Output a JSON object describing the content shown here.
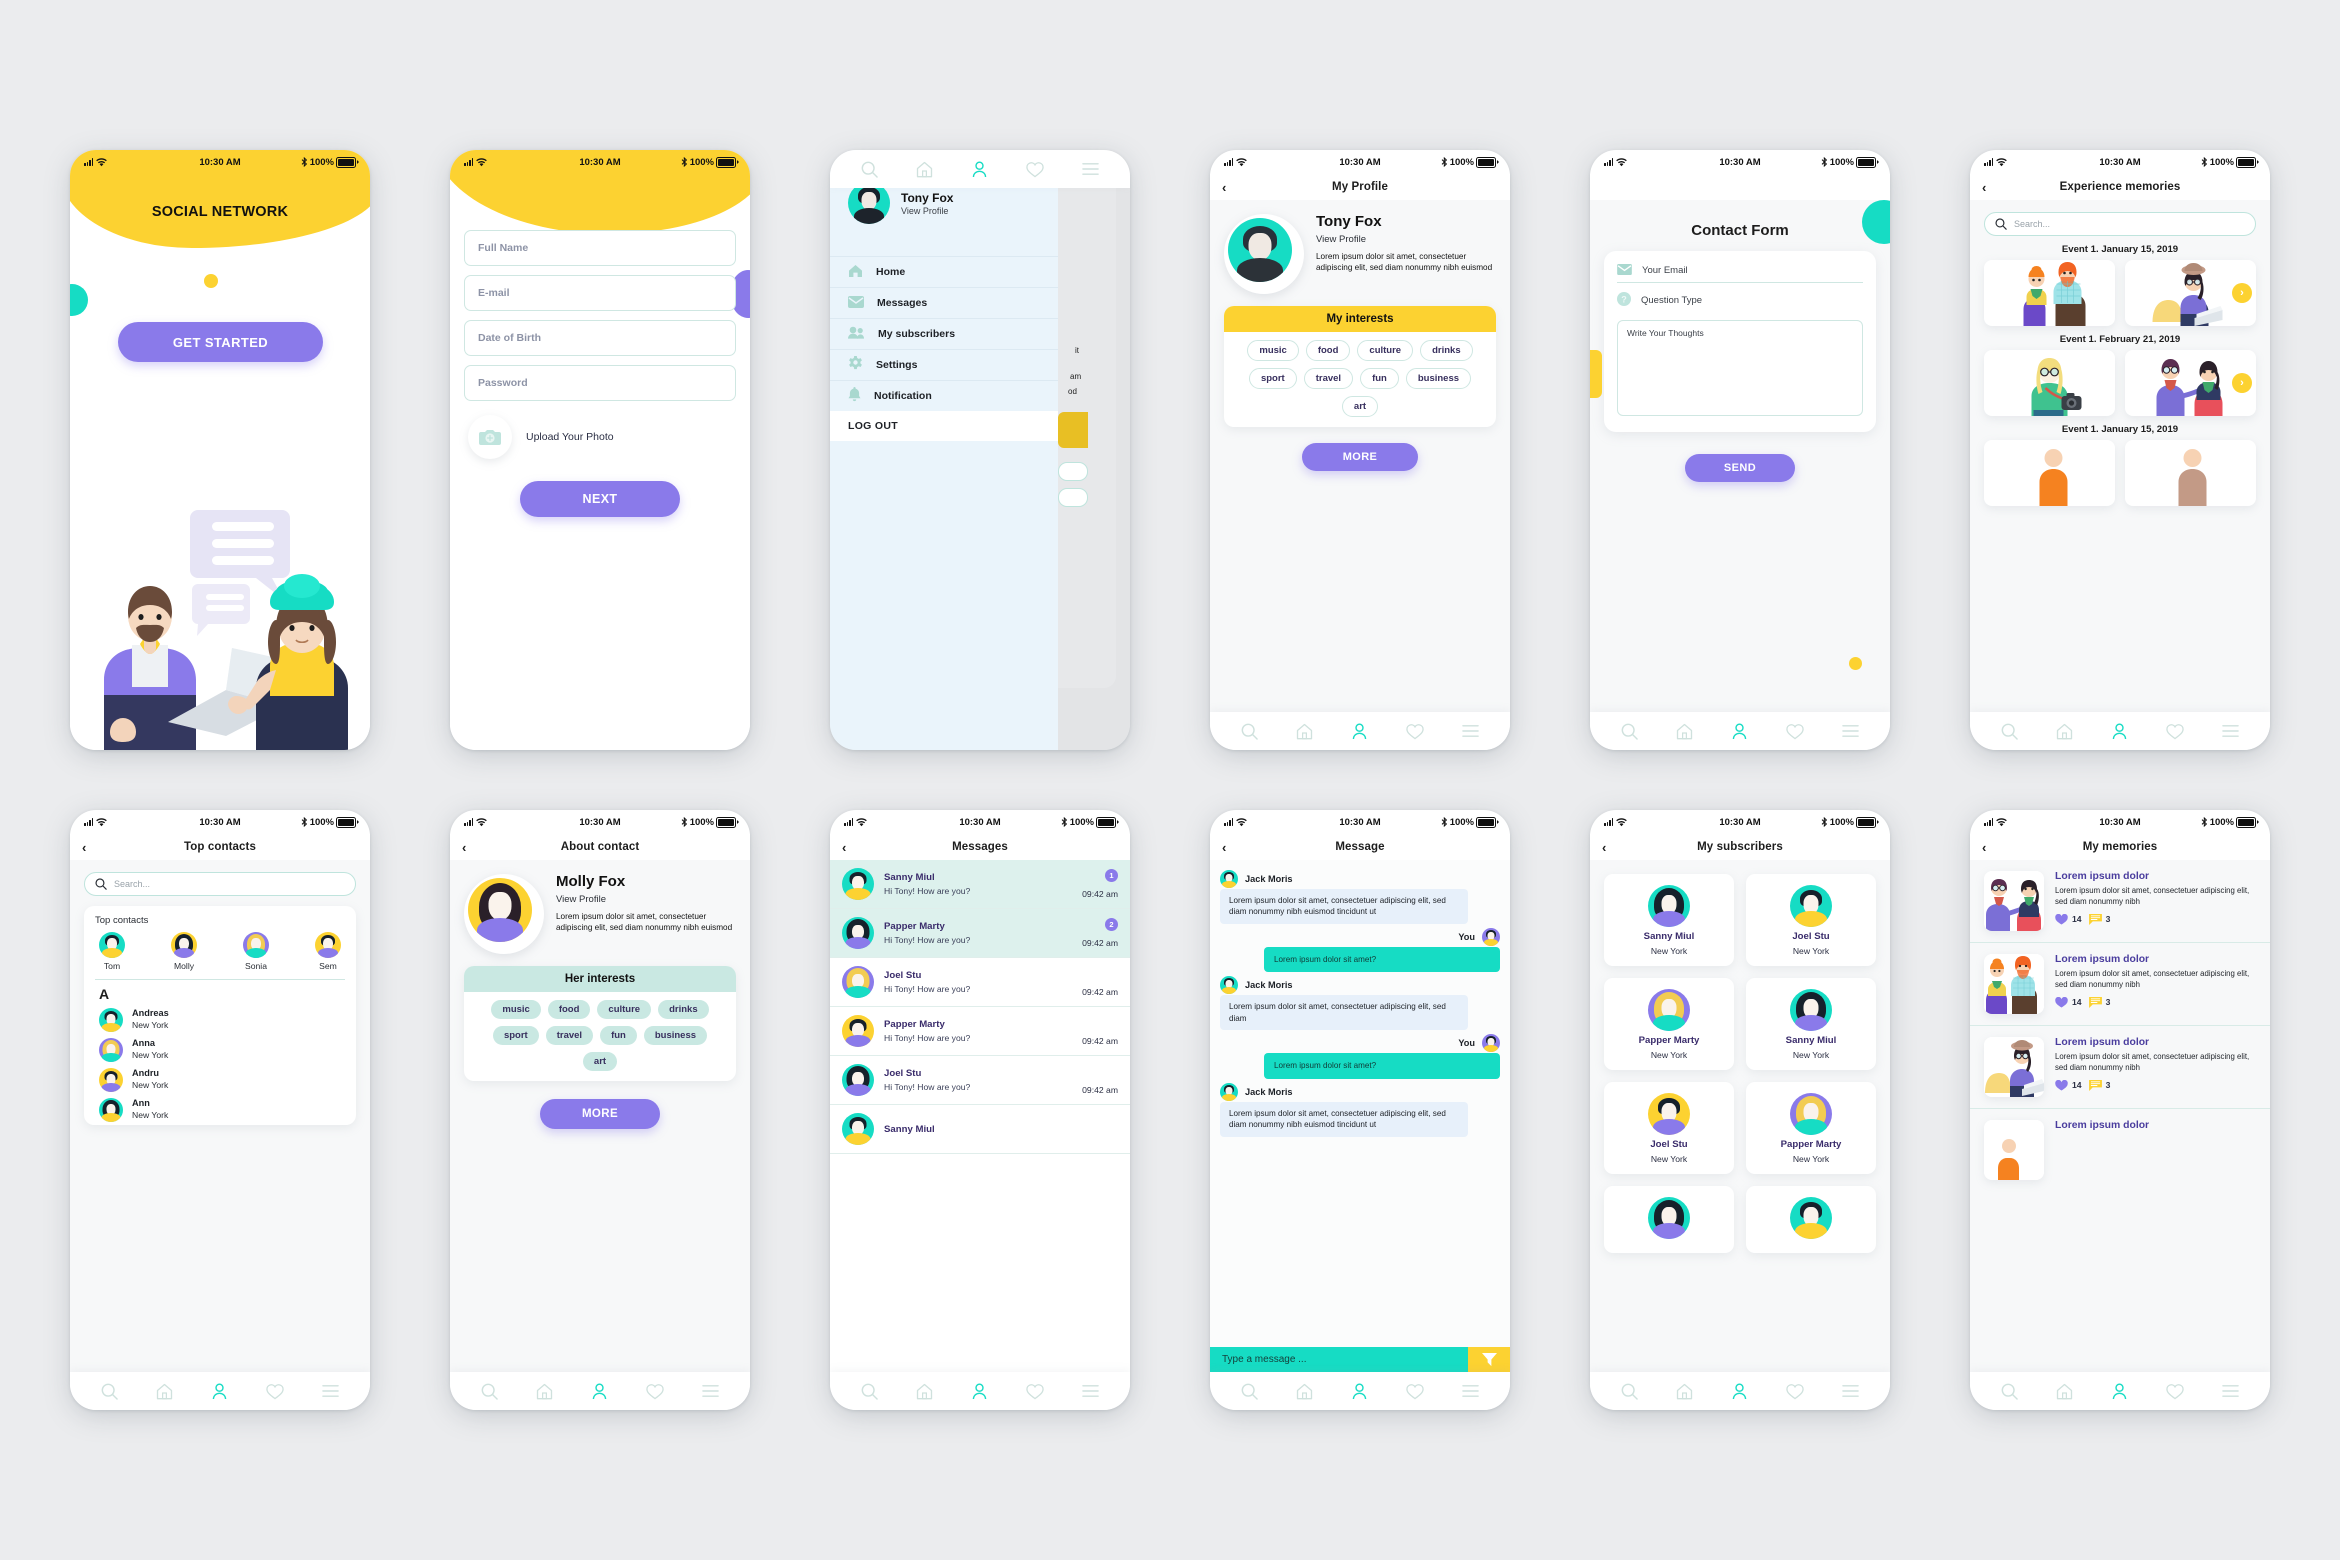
{
  "status_bar": {
    "time": "10:30 AM",
    "battery": "100%"
  },
  "theme": {
    "yellow": "#fcd231",
    "teal": "#16dcc4",
    "purple": "#8a7aea",
    "mint_border": "#cfe7e2",
    "page_bg": "#ebecee"
  },
  "screens": [
    {
      "id": "onboarding",
      "title": "SOCIAL NETWORK",
      "cta": "GET STARTED"
    },
    {
      "id": "sign-up",
      "fields": [
        {
          "name": "full-name",
          "placeholder": "Full Name"
        },
        {
          "name": "email",
          "placeholder": "E-mail"
        },
        {
          "name": "date-of-birth",
          "placeholder": "Date of Birth"
        },
        {
          "name": "password",
          "placeholder": "Password"
        }
      ],
      "upload_label": "Upload Your Photo",
      "next": "NEXT"
    },
    {
      "id": "side-menu",
      "user": {
        "name": "Tony Fox",
        "sub": "View Profile"
      },
      "items": [
        {
          "icon": "home-icon",
          "label": "Home"
        },
        {
          "icon": "envelope-icon",
          "label": "Messages"
        },
        {
          "icon": "people-icon",
          "label": "My subscribers"
        },
        {
          "icon": "gear-icon",
          "label": "Settings"
        },
        {
          "icon": "bell-icon",
          "label": "Notification"
        }
      ],
      "logout": "LOG OUT",
      "peek": {
        "l1": "it",
        "l2": "am",
        "l3": "od"
      }
    },
    {
      "id": "my-profile",
      "nav_title": "My Profile",
      "name": "Tony Fox",
      "sub": "View Profile",
      "desc": "Lorem ipsum dolor sit amet, consectetuer adipiscing elit, sed diam nonummy nibh euismod",
      "interests_title": "My interests",
      "interests": [
        "music",
        "food",
        "culture",
        "drinks",
        "sport",
        "travel",
        "fun",
        "business",
        "art"
      ],
      "more": "MORE"
    },
    {
      "id": "contact-form",
      "title": "Contact Form",
      "email_placeholder": "Your Email",
      "question_placeholder": "Question Type",
      "thoughts_placeholder": "Write Your Thoughts",
      "send": "SEND"
    },
    {
      "id": "experience-memories",
      "nav_title": "Experience memories",
      "search_placeholder": "Search...",
      "events": [
        "Event 1. January 15, 2019",
        "Event 1. February 21, 2019",
        "Event 1. January 15, 2019"
      ]
    },
    {
      "id": "top-contacts",
      "nav_title": "Top contacts",
      "search_placeholder": "Search...",
      "section_title": "Top contacts",
      "top": [
        {
          "name": "Tom",
          "bg": "#16dcc4",
          "shirt": "#fcd231",
          "hair": "#16212b",
          "long": false
        },
        {
          "name": "Molly",
          "bg": "#fcd231",
          "shirt": "#8a7aea",
          "hair": "#16212b",
          "long": true
        },
        {
          "name": "Sonia",
          "bg": "#8a7aea",
          "shirt": "#16dcc4",
          "hair": "#f2cc52",
          "long": true
        },
        {
          "name": "Sem",
          "bg": "#fcd231",
          "shirt": "#8a7aea",
          "hair": "#16212b",
          "long": false
        }
      ],
      "letter": "A",
      "contacts": [
        {
          "name": "Andreas",
          "city": "New York",
          "bg": "#16dcc4",
          "shirt": "#fcd231",
          "hair": "#16212b",
          "long": false
        },
        {
          "name": "Anna",
          "city": "New York",
          "bg": "#8a7aea",
          "shirt": "#16dcc4",
          "hair": "#f2cc52",
          "long": true
        },
        {
          "name": "Andru",
          "city": "New York",
          "bg": "#fcd231",
          "shirt": "#8a7aea",
          "hair": "#16212b",
          "long": false
        },
        {
          "name": "Ann",
          "city": "New York",
          "bg": "#16dcc4",
          "shirt": "#fcd231",
          "hair": "#16212b",
          "long": true
        }
      ]
    },
    {
      "id": "about-contact",
      "nav_title": "About contact",
      "name": "Molly Fox",
      "sub": "View Profile",
      "desc": "Lorem ipsum dolor sit amet, consectetuer adipiscing elit, sed diam nonummy nibh euismod",
      "interests_title": "Her interests",
      "interests": [
        "music",
        "food",
        "culture",
        "drinks",
        "sport",
        "travel",
        "fun",
        "business",
        "art"
      ],
      "more": "MORE"
    },
    {
      "id": "messages",
      "nav_title": "Messages",
      "items": [
        {
          "name": "Sanny Miul",
          "preview": "Hi Tony! How are you?",
          "time": "09:42 am",
          "badge": "1",
          "unread": true,
          "bg": "#16dcc4",
          "shirt": "#fcd231",
          "hair": "#16212b",
          "long": false
        },
        {
          "name": "Papper Marty",
          "preview": "Hi Tony! How are you?",
          "time": "09:42 am",
          "badge": "2",
          "unread": true,
          "bg": "#16dcc4",
          "shirt": "#8a7aea",
          "hair": "#16212b",
          "long": true
        },
        {
          "name": "Joel Stu",
          "preview": "Hi Tony! How are you?",
          "time": "09:42 am",
          "badge": "",
          "unread": false,
          "bg": "#8a7aea",
          "shirt": "#16dcc4",
          "hair": "#f2cc52",
          "long": true
        },
        {
          "name": "Papper Marty",
          "preview": "Hi Tony! How are you?",
          "time": "09:42 am",
          "badge": "",
          "unread": false,
          "bg": "#fcd231",
          "shirt": "#8a7aea",
          "hair": "#16212b",
          "long": false
        },
        {
          "name": "Joel Stu",
          "preview": "Hi Tony! How are you?",
          "time": "09:42 am",
          "badge": "",
          "unread": false,
          "bg": "#16dcc4",
          "shirt": "#8a7aea",
          "hair": "#16212b",
          "long": true
        },
        {
          "name": "Sanny Miul",
          "preview": "",
          "time": "",
          "badge": "",
          "unread": false,
          "bg": "#16dcc4",
          "shirt": "#fcd231",
          "hair": "#16212b",
          "long": false
        }
      ]
    },
    {
      "id": "message-chat",
      "nav_title": "Message",
      "them": "Jack Moris",
      "me": "You",
      "bubbles": [
        {
          "side": "in",
          "text": "Lorem ipsum dolor sit amet, consectetuer adipiscing elit, sed diam nonummy nibh euismod tincidunt ut"
        },
        {
          "side": "out",
          "text": "Lorem ipsum dolor sit amet?"
        },
        {
          "side": "in",
          "text": "Lorem ipsum dolor sit amet, consectetuer adipiscing elit, sed diam"
        },
        {
          "side": "out",
          "text": "Lorem ipsum dolor sit amet?"
        },
        {
          "side": "in",
          "text": "Lorem ipsum dolor sit amet, consectetuer adipiscing elit, sed diam nonummy nibh euismod tincidunt ut"
        }
      ],
      "input_placeholder": "Type a message ..."
    },
    {
      "id": "my-subscribers",
      "nav_title": "My subscribers",
      "items": [
        {
          "name": "Sanny Miul",
          "city": "New York",
          "bg": "#16dcc4",
          "shirt": "#8a7aea",
          "hair": "#16212b",
          "long": true
        },
        {
          "name": "Joel Stu",
          "city": "New York",
          "bg": "#16dcc4",
          "shirt": "#fcd231",
          "hair": "#16212b",
          "long": false
        },
        {
          "name": "Papper Marty",
          "city": "New York",
          "bg": "#8a7aea",
          "shirt": "#16dcc4",
          "hair": "#f2cc52",
          "long": true
        },
        {
          "name": "Sanny Miul",
          "city": "New York",
          "bg": "#16dcc4",
          "shirt": "#8a7aea",
          "hair": "#16212b",
          "long": true
        },
        {
          "name": "Joel Stu",
          "city": "New York",
          "bg": "#fcd231",
          "shirt": "#8a7aea",
          "hair": "#16212b",
          "long": false
        },
        {
          "name": "Papper Marty",
          "city": "New York",
          "bg": "#8a7aea",
          "shirt": "#16dcc4",
          "hair": "#f2cc52",
          "long": true
        },
        {
          "name": "",
          "city": "",
          "bg": "#16dcc4",
          "shirt": "#8a7aea",
          "hair": "#16212b",
          "long": true
        },
        {
          "name": "",
          "city": "",
          "bg": "#16dcc4",
          "shirt": "#fcd231",
          "hair": "#16212b",
          "long": false
        }
      ]
    },
    {
      "id": "my-memories",
      "nav_title": "My memories",
      "items": [
        {
          "title": "Lorem ipsum dolor",
          "text": "Lorem ipsum dolor sit amet, consectetuer adipiscing elit, sed diam nonummy nibh",
          "likes": "14",
          "comments": "3",
          "art": "couple-glasses"
        },
        {
          "title": "Lorem ipsum dolor",
          "text": "Lorem ipsum dolor sit amet, consectetuer adipiscing elit, sed diam nonummy nibh",
          "likes": "14",
          "comments": "3",
          "art": "couple-ginger"
        },
        {
          "title": "Lorem ipsum dolor",
          "text": "Lorem ipsum dolor sit amet, consectetuer adipiscing elit, sed diam nonummy nibh",
          "likes": "14",
          "comments": "3",
          "art": "girl-laptop"
        },
        {
          "title": "Lorem ipsum dolor",
          "text": "",
          "likes": "",
          "comments": "",
          "art": "couple-ginger"
        }
      ]
    }
  ],
  "tabbar": [
    "search-icon",
    "home-icon",
    "person-icon",
    "heart-icon",
    "menu-icon"
  ]
}
